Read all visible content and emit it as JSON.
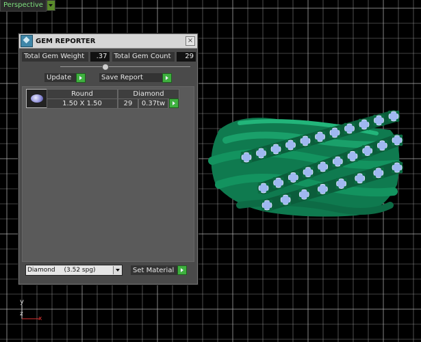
{
  "viewport": {
    "label": "Perspective",
    "axis": {
      "y": "y",
      "z": "z",
      "x": "x"
    },
    "colors": {
      "grid": "#bdbdbd",
      "ring": "#0f8a5a",
      "gems": "#9fb8f0",
      "prongs": "#0b6b42"
    }
  },
  "panel": {
    "title": "GEM REPORTER",
    "close_icon": "close-icon",
    "total_gem_weight_label": "Total Gem Weight",
    "total_gem_weight_value": ".37",
    "total_gem_count_label": "Total Gem Count",
    "total_gem_count_value": "29",
    "update_label": "Update",
    "save_report_label": "Save Report",
    "table": {
      "headers": {
        "shape": "Round",
        "material": "Diamond"
      },
      "row": {
        "size": "1.50 X 1.50",
        "count": "29",
        "weight": "0.37tw"
      }
    },
    "material_select": {
      "name": "Diamond",
      "spg": "(3.52 spg)"
    },
    "set_material_label": "Set Material"
  }
}
